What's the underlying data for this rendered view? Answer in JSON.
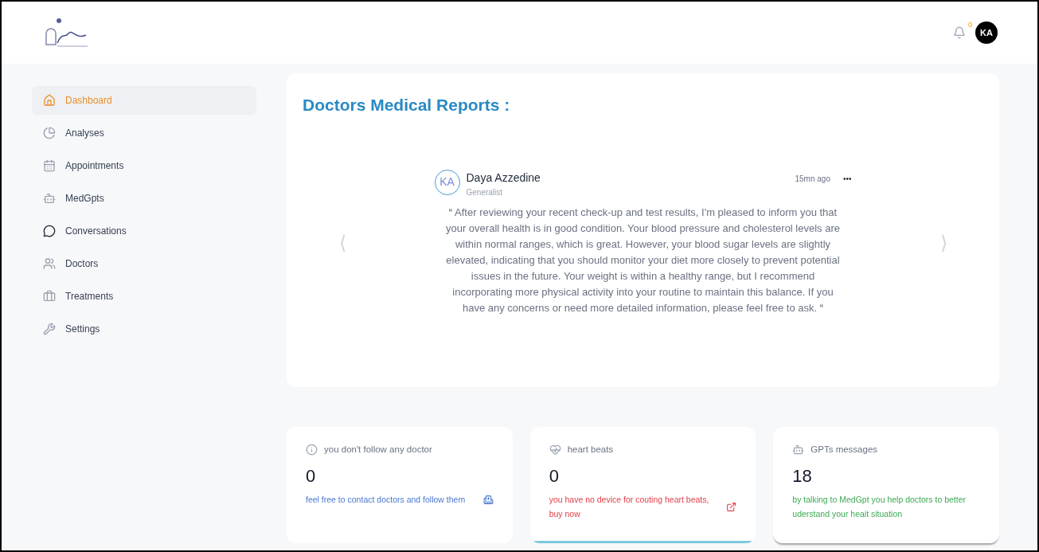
{
  "header": {
    "notification_count": "0",
    "avatar": "KA"
  },
  "sidebar": {
    "items": [
      {
        "label": "Dashboard",
        "selected": true
      },
      {
        "label": "Analyses",
        "selected": false
      },
      {
        "label": "Appointments",
        "selected": false
      },
      {
        "label": "MedGpts",
        "selected": false
      },
      {
        "label": "Conversations",
        "selected": false
      },
      {
        "label": "Doctors",
        "selected": false
      },
      {
        "label": "Treatments",
        "selected": false
      },
      {
        "label": "Settings",
        "selected": false
      }
    ]
  },
  "reports": {
    "title": "Doctors Medical Reports :",
    "prev": "⟨",
    "next": "⟩",
    "report": {
      "avatar": "KA",
      "name": "Daya Azzedine",
      "role": "Generalist",
      "time": "15mn ago",
      "menu": "•••",
      "open_quote": "“",
      "close_quote": "“",
      "text": "After reviewing your recent check-up and test results, I'm pleased to inform you that your overall health is in good condition. Your blood pressure and cholesterol levels are within normal ranges, which is great. However, your blood sugar levels are slightly elevated, indicating that you should monitor your diet more closely to prevent potential issues in the future. Your weight is within a healthy range, but I recommend incorporating more physical activity into your routine to maintain this balance. If you have any concerns or need more detailed information, please feel free to ask."
    }
  },
  "stats": [
    {
      "title": "you don't follow any doctor",
      "value": "0",
      "note": "feel free to contact doctors and follow them",
      "color": "#4a78d0",
      "selected": false
    },
    {
      "title": "heart beats",
      "value": "0",
      "note": "you have no device for couting heart beats, buy now",
      "color": "#e0404a",
      "selected": true
    },
    {
      "title": "GPTs messages",
      "value": "18",
      "note": "by talking to MedGpt you help doctors to better uderstand your heait situation",
      "color": "#3daa55",
      "selected": false
    }
  ]
}
